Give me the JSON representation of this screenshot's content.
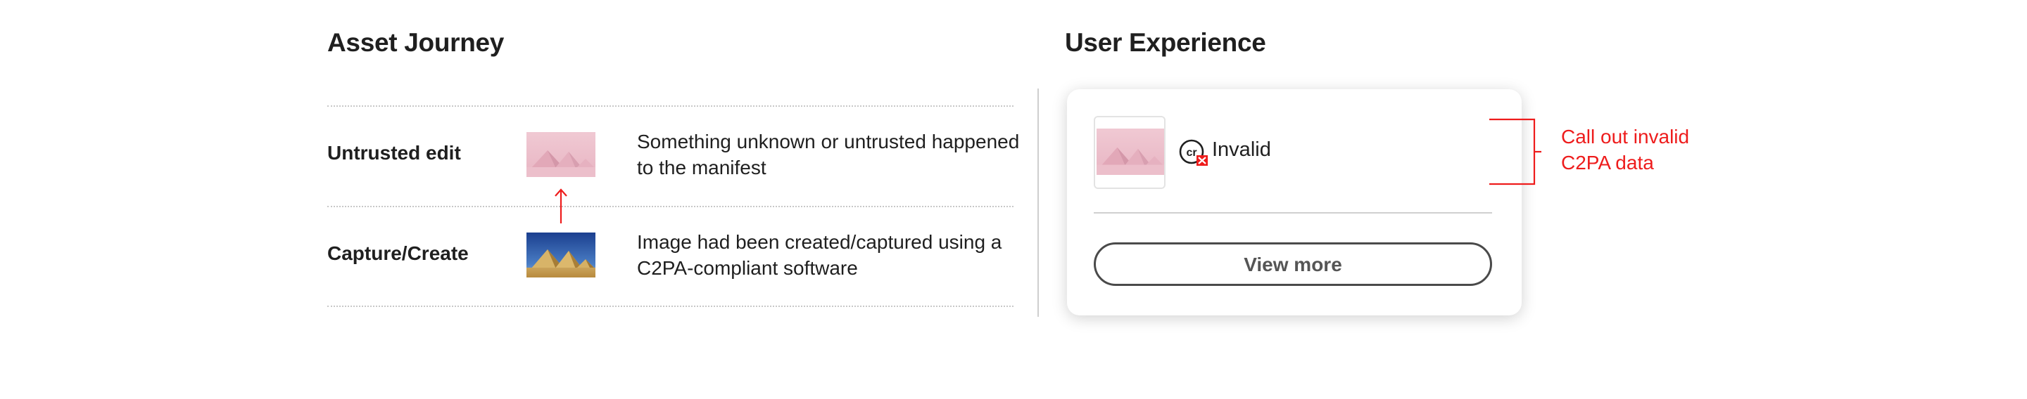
{
  "asset_journey": {
    "title": "Asset Journey",
    "rows": [
      {
        "label": "Untrusted edit",
        "description": "Something unknown or untrusted happened to the manifest",
        "thumbnail": "pyramids-tinted-pink-image"
      },
      {
        "label": "Capture/Create",
        "description": "Image had been created/captured using a C2PA-compliant software",
        "thumbnail": "pyramids-original-image"
      }
    ],
    "connector_icon": "arrow-up-icon"
  },
  "user_experience": {
    "title": "User Experience",
    "card": {
      "status_icon": "content-credentials-invalid-icon",
      "status_label": "Invalid",
      "button_label": "View more"
    },
    "callout": {
      "text": "Call out invalid C2PA data"
    }
  },
  "colors": {
    "accent_red": "#ee1c1c",
    "text": "#1f1f1f",
    "divider": "#cfcfcf",
    "button_border": "#4a4a4a"
  }
}
